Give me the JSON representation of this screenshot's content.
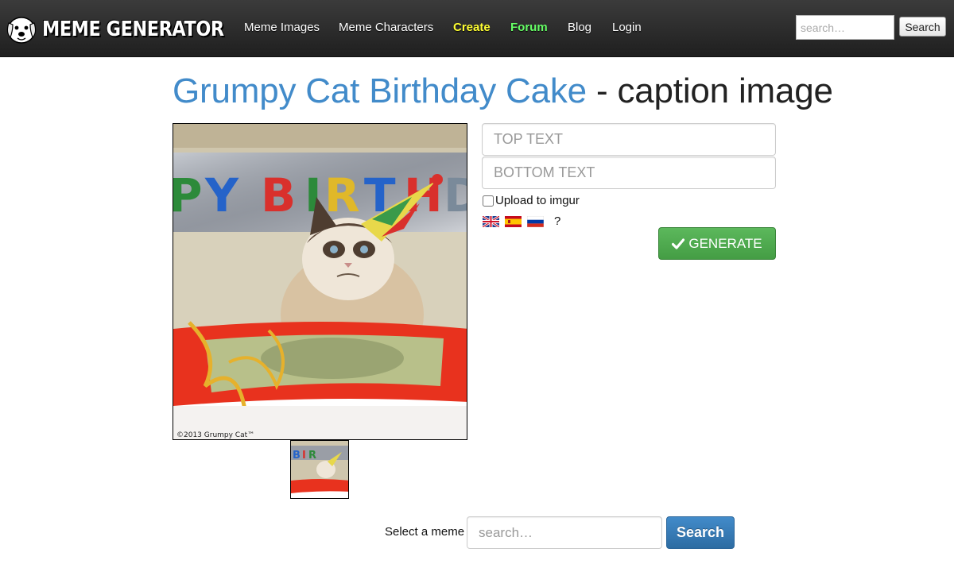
{
  "navbar": {
    "logo_text": "MEME GENERATOR",
    "links": [
      {
        "label": "Meme Images"
      },
      {
        "label": "Meme Characters"
      },
      {
        "label": "Create",
        "color": "#ffff33"
      },
      {
        "label": "Forum",
        "color": "#66ff66"
      },
      {
        "label": "Blog"
      },
      {
        "label": "Login"
      }
    ],
    "search_placeholder": "search…",
    "search_button": "Search"
  },
  "heading": {
    "meme_name": "Grumpy Cat Birthday Cake",
    "suffix": " - caption image",
    "meme_name_color": "#428bca"
  },
  "image": {
    "banner_letters": [
      "P",
      "Y",
      "B",
      "I",
      "R",
      "T",
      "H",
      "D"
    ],
    "watermark": "©2013 Grumpy Cat™"
  },
  "form": {
    "top_text_placeholder": "TOP TEXT",
    "bottom_text_placeholder": "BOTTOM TEXT",
    "upload_label": "Upload to imgur",
    "upload_checked": false,
    "languages": [
      "uk-flag-icon",
      "spain-flag-icon",
      "russia-flag-icon"
    ],
    "help_label": "?",
    "generate_label": "GENERATE",
    "generate_color": "#5cb85c"
  },
  "select": {
    "label": "Select a meme",
    "placeholder": "search…",
    "button": "Search",
    "button_color": "#428bca"
  }
}
